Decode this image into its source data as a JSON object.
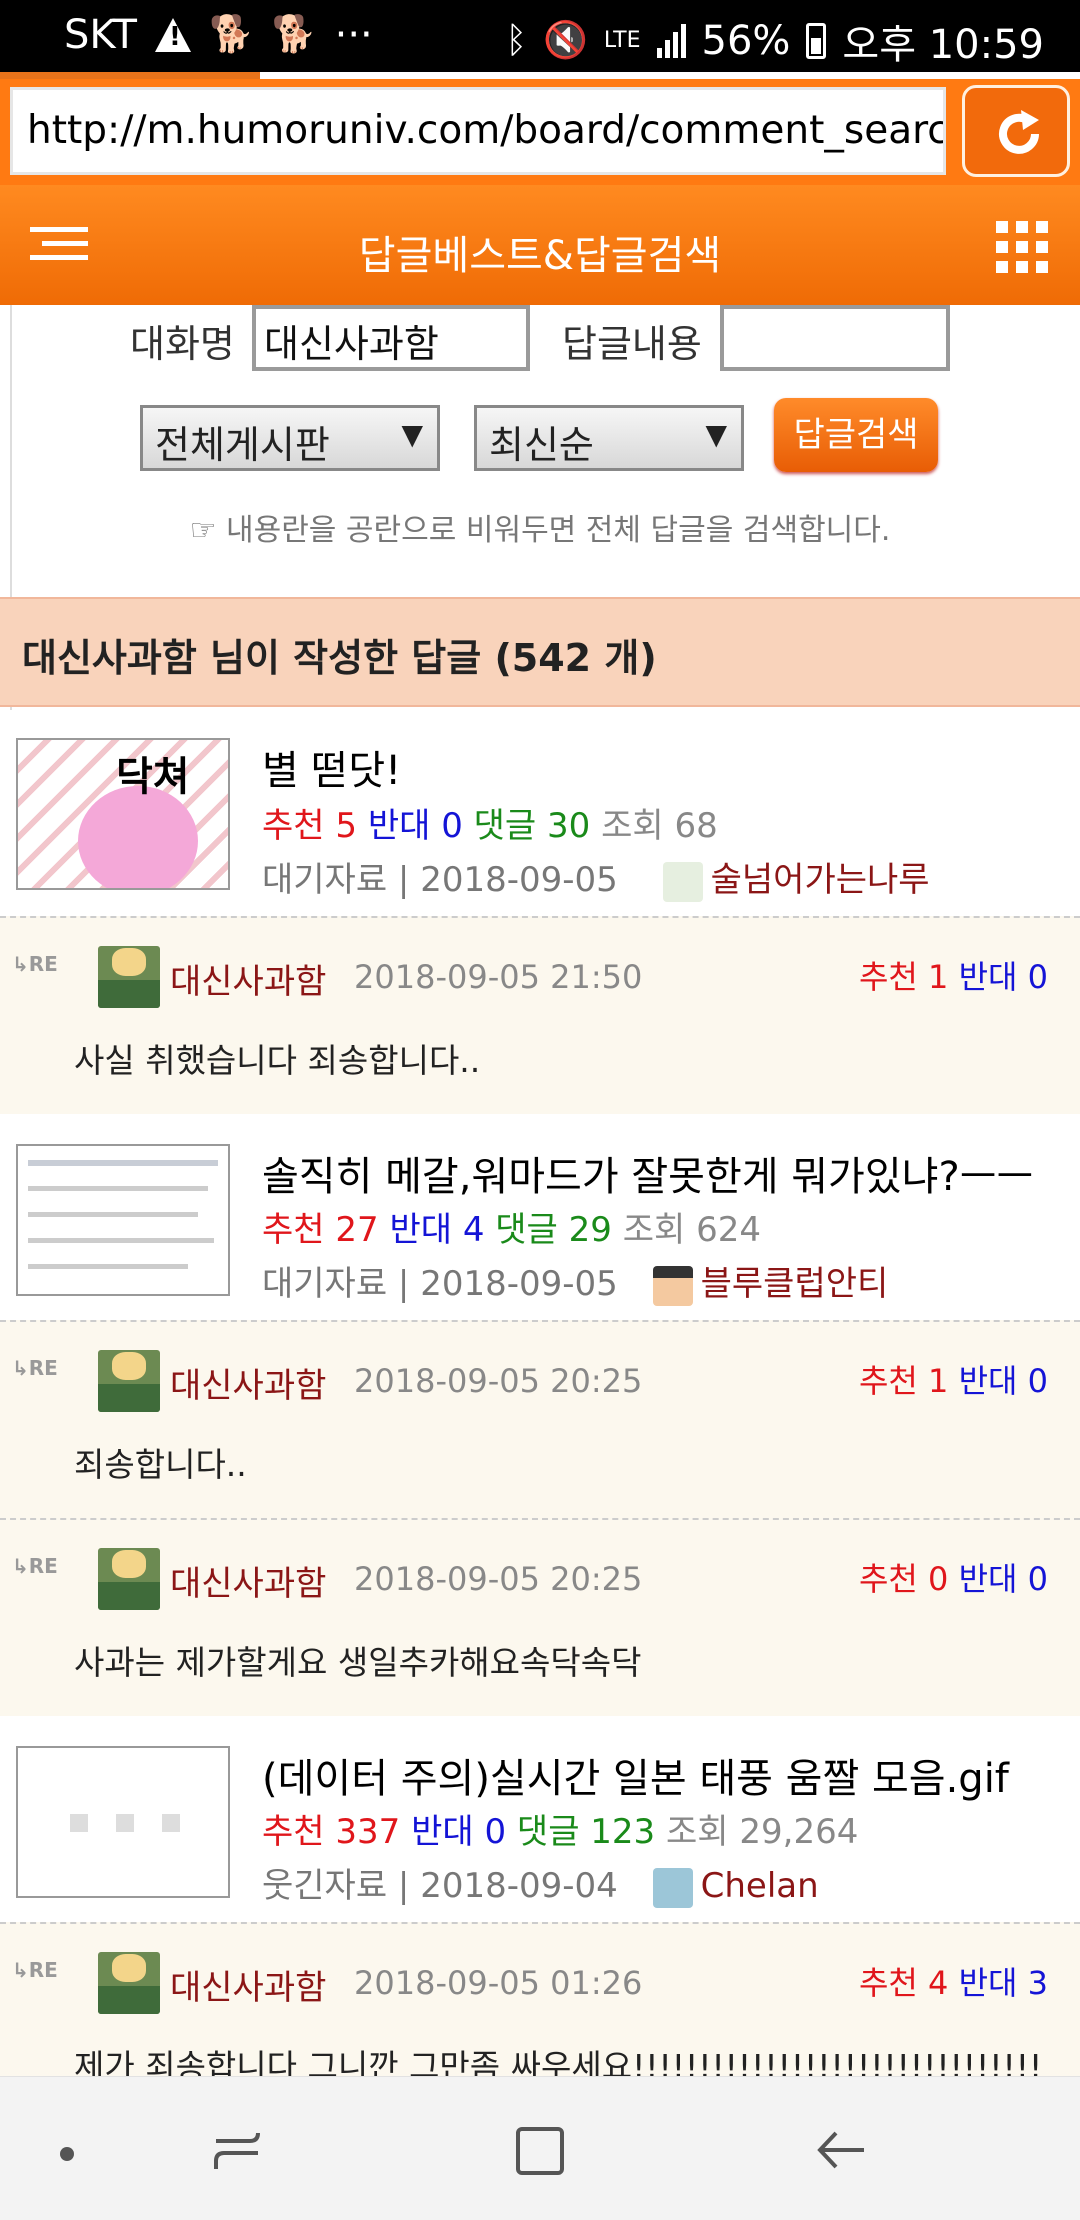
{
  "status_bar": {
    "carrier": "SKT",
    "more": "···",
    "network": "LTE",
    "battery": "56%",
    "time": "오후 10:59"
  },
  "browser": {
    "url": "http://m.humoruniv.com/board/comment_search"
  },
  "header": {
    "title": "답글베스트&답글검색"
  },
  "search": {
    "nickname_label": "대화명",
    "nickname_value": "대신사과함",
    "content_label": "답글내용",
    "content_value": "",
    "board_select": "전체게시판",
    "sort_select": "최신순",
    "search_button": "답글검색",
    "hint": "내용란을 공란으로 비워두면 전체 답글을 검색합니다."
  },
  "results": {
    "heading": "대신사과함 님이 작성한 답글 (542 개)"
  },
  "labels": {
    "recommend": "추천",
    "oppose": "반대",
    "comments": "댓글",
    "views": "조회",
    "re": "RE"
  },
  "posts": [
    {
      "title": "별 떧닷!",
      "recommend": "5",
      "oppose": "0",
      "comments": "30",
      "views": "68",
      "board": "대기자료",
      "date": "2018-09-05",
      "author": "술넘어가는나루",
      "thumb_text": "닥쳐"
    },
    {
      "title": "솔직히 메갈,워마드가 잘못한게 뭐가있냐?ㅡㅡ",
      "recommend": "27",
      "oppose": "4",
      "comments": "29",
      "views": "624",
      "board": "대기자료",
      "date": "2018-09-05",
      "author": "블루클럽안티"
    },
    {
      "title": "(데이터 주의)실시간 일본 태풍 움짤 모음.gif",
      "recommend": "337",
      "oppose": "0",
      "comments": "123",
      "views": "29,264",
      "board": "웃긴자료",
      "date": "2018-09-04",
      "author": "Chelan"
    }
  ],
  "comments": [
    {
      "name": "대신사과함",
      "date": "2018-09-05 21:50",
      "recommend": "1",
      "oppose": "0",
      "body": "사실 취했습니다 죄송합니다.."
    },
    {
      "name": "대신사과함",
      "date": "2018-09-05 20:25",
      "recommend": "1",
      "oppose": "0",
      "body": "죄송합니다.."
    },
    {
      "name": "대신사과함",
      "date": "2018-09-05 20:25",
      "recommend": "0",
      "oppose": "0",
      "body": "사과는 제가할게요 생일추카해요속닥속닥"
    },
    {
      "name": "대신사과함",
      "date": "2018-09-05 01:26",
      "recommend": "4",
      "oppose": "3",
      "body": "제가 죄송합니다 그니깐 그만좀 싸우세요!!!!!!!!!!!!!!!!!!!!!!!!!!!!!!!"
    }
  ],
  "colors": {
    "accent": "#f47a14",
    "recommend": "#e0161b",
    "oppose": "#1414d6",
    "comments": "#1a8a1a",
    "author": "#8b1616"
  }
}
